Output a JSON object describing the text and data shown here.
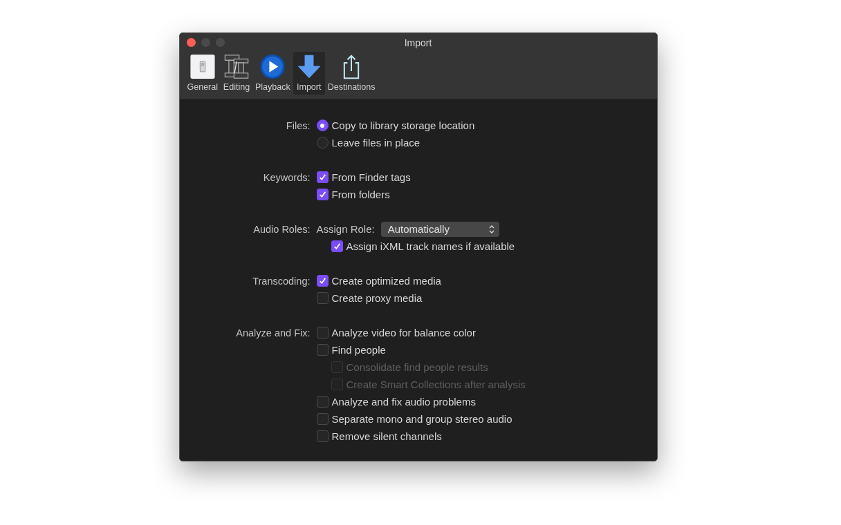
{
  "window": {
    "title": "Import"
  },
  "tabs": [
    {
      "label": "General",
      "selected": false
    },
    {
      "label": "Editing",
      "selected": false
    },
    {
      "label": "Playback",
      "selected": false
    },
    {
      "label": "Import",
      "selected": true
    },
    {
      "label": "Destinations",
      "selected": false
    }
  ],
  "sections": [
    {
      "label": "Files:",
      "rows": [
        {
          "kind": "radio",
          "label": "Copy to library storage location",
          "selected": true
        },
        {
          "kind": "radio",
          "label": "Leave files in place",
          "selected": false
        }
      ]
    },
    {
      "label": "Keywords:",
      "rows": [
        {
          "kind": "checkbox",
          "label": "From Finder tags",
          "checked": true,
          "disabled": false
        },
        {
          "kind": "checkbox",
          "label": "From folders",
          "checked": true,
          "disabled": false
        }
      ]
    },
    {
      "label": "Audio Roles:",
      "rows": [
        {
          "kind": "popup",
          "label": "Assign Role:",
          "value": "Automatically",
          "children": [
            {
              "kind": "checkbox",
              "label": "Assign iXML track names if available",
              "checked": true,
              "disabled": false
            }
          ]
        }
      ]
    },
    {
      "label": "Transcoding:",
      "rows": [
        {
          "kind": "checkbox",
          "label": "Create optimized media",
          "checked": true,
          "disabled": false
        },
        {
          "kind": "checkbox",
          "label": "Create proxy media",
          "checked": false,
          "disabled": false
        }
      ]
    },
    {
      "label": "Analyze and Fix:",
      "rows": [
        {
          "kind": "checkbox",
          "label": "Analyze video for balance color",
          "checked": false,
          "disabled": false
        },
        {
          "kind": "checkbox",
          "label": "Find people",
          "checked": false,
          "disabled": false,
          "children": [
            {
              "kind": "checkbox",
              "label": "Consolidate find people results",
              "checked": false,
              "disabled": true
            },
            {
              "kind": "checkbox",
              "label": "Create Smart Collections after analysis",
              "checked": false,
              "disabled": true
            }
          ]
        },
        {
          "kind": "checkbox",
          "label": "Analyze and fix audio problems",
          "checked": false,
          "disabled": false
        },
        {
          "kind": "checkbox",
          "label": "Separate mono and group stereo audio",
          "checked": false,
          "disabled": false
        },
        {
          "kind": "checkbox",
          "label": "Remove silent channels",
          "checked": false,
          "disabled": false
        }
      ]
    }
  ]
}
